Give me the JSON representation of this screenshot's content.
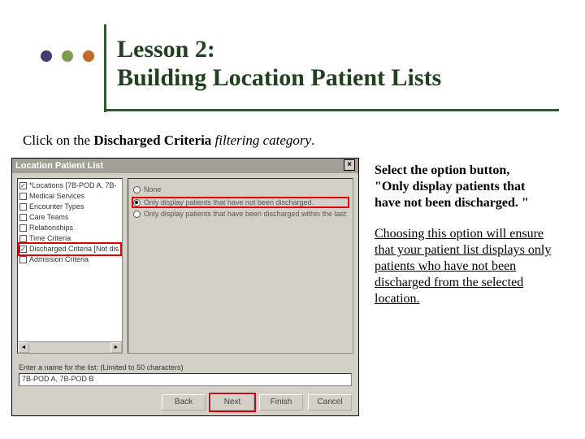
{
  "colors": {
    "dot1": "#4a3a6f",
    "dot2": "#7c9c4f",
    "dot3": "#c26a28",
    "title": "#20401f"
  },
  "header": {
    "title_line1": "Lesson 2:",
    "title_line2": "Building Location Patient Lists"
  },
  "instruction": {
    "prefix": "Click on the ",
    "bold": "Discharged Criteria",
    "italic": " filtering category",
    "suffix": "."
  },
  "side": {
    "p1_bold1": "Select the option button,",
    "p1_bold2": "\"Only display patients that have not been discharged. \"",
    "p2": "Choosing this option will ensure that your patient list displays only patients who have not been discharged from the selected location."
  },
  "dialog": {
    "title": "Location Patient List",
    "close": "×",
    "list": [
      {
        "checked": true,
        "label": "*Locations [7B-POD A, 7B-"
      },
      {
        "checked": false,
        "label": "Medical Services"
      },
      {
        "checked": false,
        "label": "Encounter Types"
      },
      {
        "checked": false,
        "label": "Care Teams"
      },
      {
        "checked": false,
        "label": "Relationships"
      },
      {
        "checked": false,
        "label": "Time Criteria"
      },
      {
        "checked": true,
        "label": "Discharged Criteria [Not dis",
        "highlight": true
      },
      {
        "checked": false,
        "label": "Admission Criteria"
      }
    ],
    "scroll": {
      "left": "◄",
      "right": "►"
    },
    "radios": [
      {
        "selected": false,
        "label": "None",
        "highlight": false
      },
      {
        "selected": true,
        "label": "Only display patients that have not been discharged.",
        "highlight": true
      },
      {
        "selected": false,
        "label": "Only display patients that have been discharged within the last:",
        "highlight": false
      }
    ],
    "name_label": "Enter a name for the list: (Limited to 50 characters)",
    "name_value": "7B-POD A, 7B-POD B",
    "buttons": {
      "back": "Back",
      "next": "Next",
      "finish": "Finish",
      "cancel": "Cancel"
    }
  }
}
